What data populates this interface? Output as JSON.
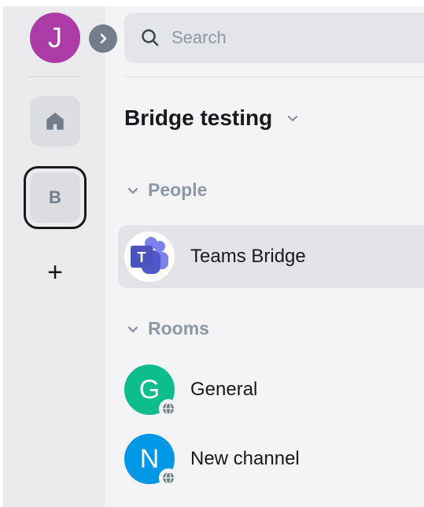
{
  "user": {
    "initial": "J"
  },
  "search": {
    "placeholder": "Search"
  },
  "spaces": {
    "current_initial": "B",
    "add_label": "+"
  },
  "space": {
    "title": "Bridge testing"
  },
  "sections": {
    "people": {
      "label": "People"
    },
    "rooms": {
      "label": "Rooms"
    }
  },
  "people": [
    {
      "name": "Teams Bridge",
      "icon": "microsoft-teams-icon"
    }
  ],
  "rooms": [
    {
      "name": "General",
      "initial": "G",
      "color": "#0dbd8b"
    },
    {
      "name": "New channel",
      "initial": "N",
      "color": "#0097e6"
    }
  ],
  "colors": {
    "user_avatar": "#ac3ba8",
    "rail_bg": "#ebebed",
    "panel_bg": "#f4f4f6",
    "teams_purple": "#5059c9"
  }
}
